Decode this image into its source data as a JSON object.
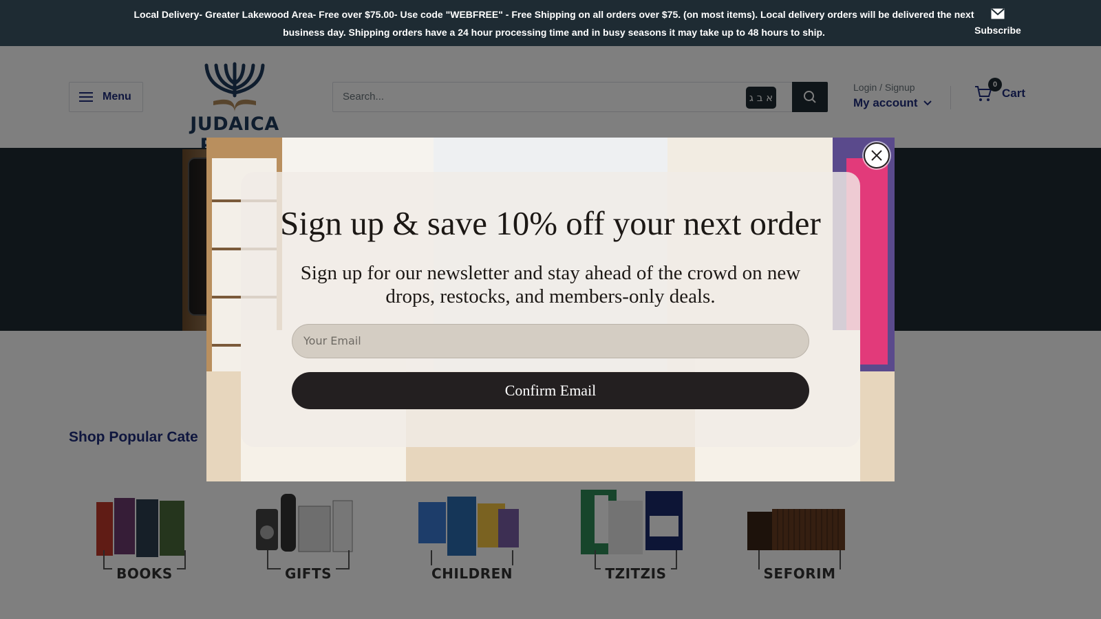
{
  "announcement": {
    "text": "Local Delivery- Greater Lakewood Area- Free over $75.00- Use code \"WEBFREE\" - Free Shipping on all orders over $75. (on most items). Local delivery orders will be delivered the next business day. Shipping orders have a 24 hour processing time and in busy seasons it may take up to 48 hours to ship.",
    "subscribe_label": "Subscribe",
    "subscribe_icon": "mail-icon"
  },
  "header": {
    "menu_label": "Menu",
    "logo_text": "JUDAICA PLAZA",
    "search_placeholder": "Search...",
    "hebrew_keyboard_label": "א ב ג",
    "login_label": "Login / Signup",
    "account_label": "My account",
    "cart_label": "Cart",
    "cart_count": "0"
  },
  "section": {
    "title": "Shop Popular Cate"
  },
  "categories": [
    {
      "label": "BOOKS",
      "icon": "books-image"
    },
    {
      "label": "GIFTS",
      "icon": "gifts-image"
    },
    {
      "label": "CHILDREN",
      "icon": "children-image"
    },
    {
      "label": "TZITZIS",
      "icon": "tzitzis-image"
    },
    {
      "label": "SEFORIM",
      "icon": "seforim-image"
    }
  ],
  "popup": {
    "title": "Sign up & save 10% off your next order",
    "subtitle": "Sign up for our newsletter and stay ahead of the crowd on new drops, restocks, and members-only deals.",
    "email_placeholder": "Your Email",
    "confirm_label": "Confirm Email",
    "close_icon": "close-icon"
  },
  "colors": {
    "dark_bar": "#1e2b33",
    "brand_blue": "#1e2d7d",
    "button_black": "#231f20"
  }
}
